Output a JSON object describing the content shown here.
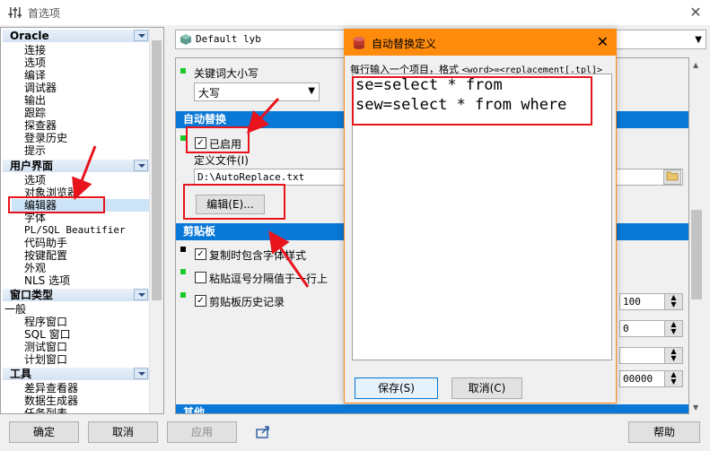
{
  "window": {
    "title": "首选项",
    "close": "✕"
  },
  "tree": {
    "groups": [
      {
        "label": "Oracle",
        "items": [
          "连接",
          "选项",
          "编译",
          "调试器",
          "输出",
          "跟踪",
          "探查器",
          "登录历史",
          "提示"
        ]
      },
      {
        "label": "用户界面",
        "items": [
          "选项",
          "对象浏览器",
          "编辑器",
          "字体",
          "PL/SQL Beautifier",
          "代码助手",
          "按键配置",
          "外观",
          "NLS 选项"
        ],
        "selected": "编辑器"
      },
      {
        "label": "窗口类型",
        "items": [
          "一般",
          "程序窗口",
          "SQL 窗口",
          "测试窗口",
          "计划窗口"
        ]
      },
      {
        "label": "工具",
        "items": [
          "差异查看器",
          "数据生成器",
          "任务列表"
        ]
      }
    ]
  },
  "connection": {
    "value": "Default lyb"
  },
  "settings": {
    "keyword_case_label": "关键词大小写",
    "keyword_case_value": "大写",
    "autoreplace_header": "自动替换",
    "enabled_label": "已启用",
    "deffile_label": "定义文件(I)",
    "deffile_value": "D:\\AutoReplace.txt",
    "edit_button": "编辑(E)...",
    "clipboard_header": "剪贴板",
    "copy_with_font": "复制时包含字体样式",
    "paste_comma": "粘贴逗号分隔值于一行上",
    "clip_history": "剪贴板历史记录",
    "num1": "100",
    "num2": "0",
    "num3": "00000",
    "bottom_header": "其他"
  },
  "buttons": {
    "ok": "确定",
    "cancel": "取消",
    "apply": "应用",
    "help": "帮助"
  },
  "dialog": {
    "title": "自动替换定义",
    "hint_prefix": "每行输入一个项目，格式 ",
    "hint_format": "<word>=<replacement[.tpl]>",
    "lines": [
      "se=select * from",
      "sew=select * from where"
    ],
    "save": "保存(S)",
    "cancel": "取消(C)"
  },
  "colors": {
    "accent": "#0a78d7",
    "dialog_title": "#fe8b0c",
    "annotation": "#e8141d",
    "marker": "#1aca2a"
  }
}
